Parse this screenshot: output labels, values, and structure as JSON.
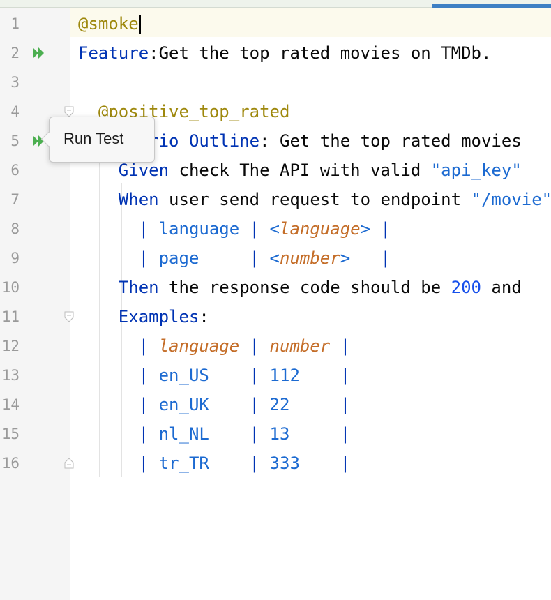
{
  "editor": {
    "lines": [
      {
        "num": "1",
        "tokens": [
          {
            "t": "@smoke",
            "c": "tag"
          }
        ]
      },
      {
        "num": "2",
        "tokens": [
          {
            "t": "Feature",
            "c": "kw"
          },
          {
            "t": ":Get the top rated movies on TMDb.",
            "c": ""
          }
        ]
      },
      {
        "num": "3",
        "tokens": []
      },
      {
        "num": "4",
        "tokens": [
          {
            "t": "  @positive_top_rated",
            "c": "tag"
          }
        ]
      },
      {
        "num": "5",
        "tokens": [
          {
            "t": "  Scenario Outline",
            "c": "kw"
          },
          {
            "t": ": Get the top rated movies",
            "c": ""
          }
        ]
      },
      {
        "num": "6",
        "tokens": [
          {
            "t": "    Given",
            "c": "kw"
          },
          {
            "t": " check The API with valid ",
            "c": ""
          },
          {
            "t": "\"api_key\"",
            "c": "str"
          }
        ]
      },
      {
        "num": "7",
        "tokens": [
          {
            "t": "    When",
            "c": "kw"
          },
          {
            "t": " user send request to endpoint ",
            "c": ""
          },
          {
            "t": "\"/movie\"",
            "c": "str"
          }
        ]
      },
      {
        "num": "8",
        "tokens": [
          {
            "t": "      | ",
            "c": "pipe"
          },
          {
            "t": "language",
            "c": "cell"
          },
          {
            "t": " | ",
            "c": "pipe"
          },
          {
            "t": "<",
            "c": "cell"
          },
          {
            "t": "language",
            "c": "ph"
          },
          {
            "t": ">",
            "c": "cell"
          },
          {
            "t": " |",
            "c": "pipe"
          }
        ]
      },
      {
        "num": "9",
        "tokens": [
          {
            "t": "      | ",
            "c": "pipe"
          },
          {
            "t": "page    ",
            "c": "cell"
          },
          {
            "t": " | ",
            "c": "pipe"
          },
          {
            "t": "<",
            "c": "cell"
          },
          {
            "t": "number",
            "c": "ph"
          },
          {
            "t": ">",
            "c": "cell"
          },
          {
            "t": "   |",
            "c": "pipe"
          }
        ]
      },
      {
        "num": "10",
        "tokens": [
          {
            "t": "    Then",
            "c": "kw"
          },
          {
            "t": " the response code should be ",
            "c": ""
          },
          {
            "t": "200",
            "c": "num"
          },
          {
            "t": " and",
            "c": ""
          }
        ]
      },
      {
        "num": "11",
        "tokens": [
          {
            "t": "    Examples",
            "c": "kw"
          },
          {
            "t": ":",
            "c": ""
          }
        ]
      },
      {
        "num": "12",
        "tokens": [
          {
            "t": "      | ",
            "c": "pipe"
          },
          {
            "t": "language",
            "c": "ph"
          },
          {
            "t": " | ",
            "c": "pipe"
          },
          {
            "t": "number",
            "c": "ph"
          },
          {
            "t": " |",
            "c": "pipe"
          }
        ]
      },
      {
        "num": "13",
        "tokens": [
          {
            "t": "      | ",
            "c": "pipe"
          },
          {
            "t": "en_US   ",
            "c": "cell"
          },
          {
            "t": " | ",
            "c": "pipe"
          },
          {
            "t": "112   ",
            "c": "cell"
          },
          {
            "t": " |",
            "c": "pipe"
          }
        ]
      },
      {
        "num": "14",
        "tokens": [
          {
            "t": "      | ",
            "c": "pipe"
          },
          {
            "t": "en_UK   ",
            "c": "cell"
          },
          {
            "t": " | ",
            "c": "pipe"
          },
          {
            "t": "22    ",
            "c": "cell"
          },
          {
            "t": " |",
            "c": "pipe"
          }
        ]
      },
      {
        "num": "15",
        "tokens": [
          {
            "t": "      | ",
            "c": "pipe"
          },
          {
            "t": "nl_NL   ",
            "c": "cell"
          },
          {
            "t": " | ",
            "c": "pipe"
          },
          {
            "t": "13    ",
            "c": "cell"
          },
          {
            "t": " |",
            "c": "pipe"
          }
        ]
      },
      {
        "num": "16",
        "tokens": [
          {
            "t": "      | ",
            "c": "pipe"
          },
          {
            "t": "tr_TR   ",
            "c": "cell"
          },
          {
            "t": " | ",
            "c": "pipe"
          },
          {
            "t": "333   ",
            "c": "cell"
          },
          {
            "t": " |",
            "c": "pipe"
          }
        ]
      }
    ],
    "run_gutter_lines": [
      "2",
      "5"
    ],
    "fold_lines": [
      "4",
      "11",
      "16"
    ],
    "caret_line": "1"
  },
  "tooltip": {
    "label": "Run Test"
  },
  "colors": {
    "keyword": "#0033b3",
    "tag": "#9e880d",
    "string": "#1c6ad1",
    "placeholder": "#c46d28",
    "run_icon": "#4caf50"
  },
  "icons": {
    "run": "run-double-arrow-icon",
    "fold": "fold-marker-icon"
  }
}
